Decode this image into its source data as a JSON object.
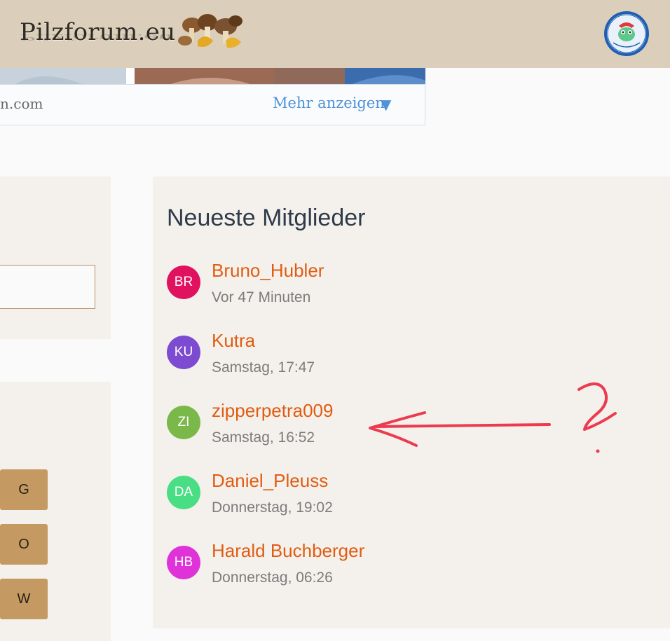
{
  "header": {
    "logo_text": "Pilzforum.eu",
    "user_avatar_icon": "user-avatar-icon"
  },
  "banner": {
    "url_fragment": "n.com",
    "more_label": "Mehr anzeigen",
    "more_arrow": "▼"
  },
  "letters": [
    "G",
    "O",
    "W"
  ],
  "members": {
    "title": "Neueste Mitglieder",
    "items": [
      {
        "initials": "BR",
        "name": "Bruno_Hubler",
        "time": "Vor 47 Minuten",
        "color": "#e0115f"
      },
      {
        "initials": "KU",
        "name": "Kutra",
        "time": "Samstag, 17:47",
        "color": "#7c4bd1"
      },
      {
        "initials": "ZI",
        "name": "zipperpetra009",
        "time": "Samstag, 16:52",
        "color": "#7bb84a"
      },
      {
        "initials": "DA",
        "name": "Daniel_Pleuss",
        "time": "Donnerstag, 19:02",
        "color": "#49de84"
      },
      {
        "initials": "HB",
        "name": "Harald Buchberger",
        "time": "Donnerstag, 06:26",
        "color": "#e032d9"
      }
    ]
  },
  "colors": {
    "header_bg": "#dbcfbb",
    "panel_bg": "#f4f1ec",
    "link": "#e15c12",
    "accent_blue": "#4f93d8",
    "annotation_red": "#ee3a4e"
  }
}
